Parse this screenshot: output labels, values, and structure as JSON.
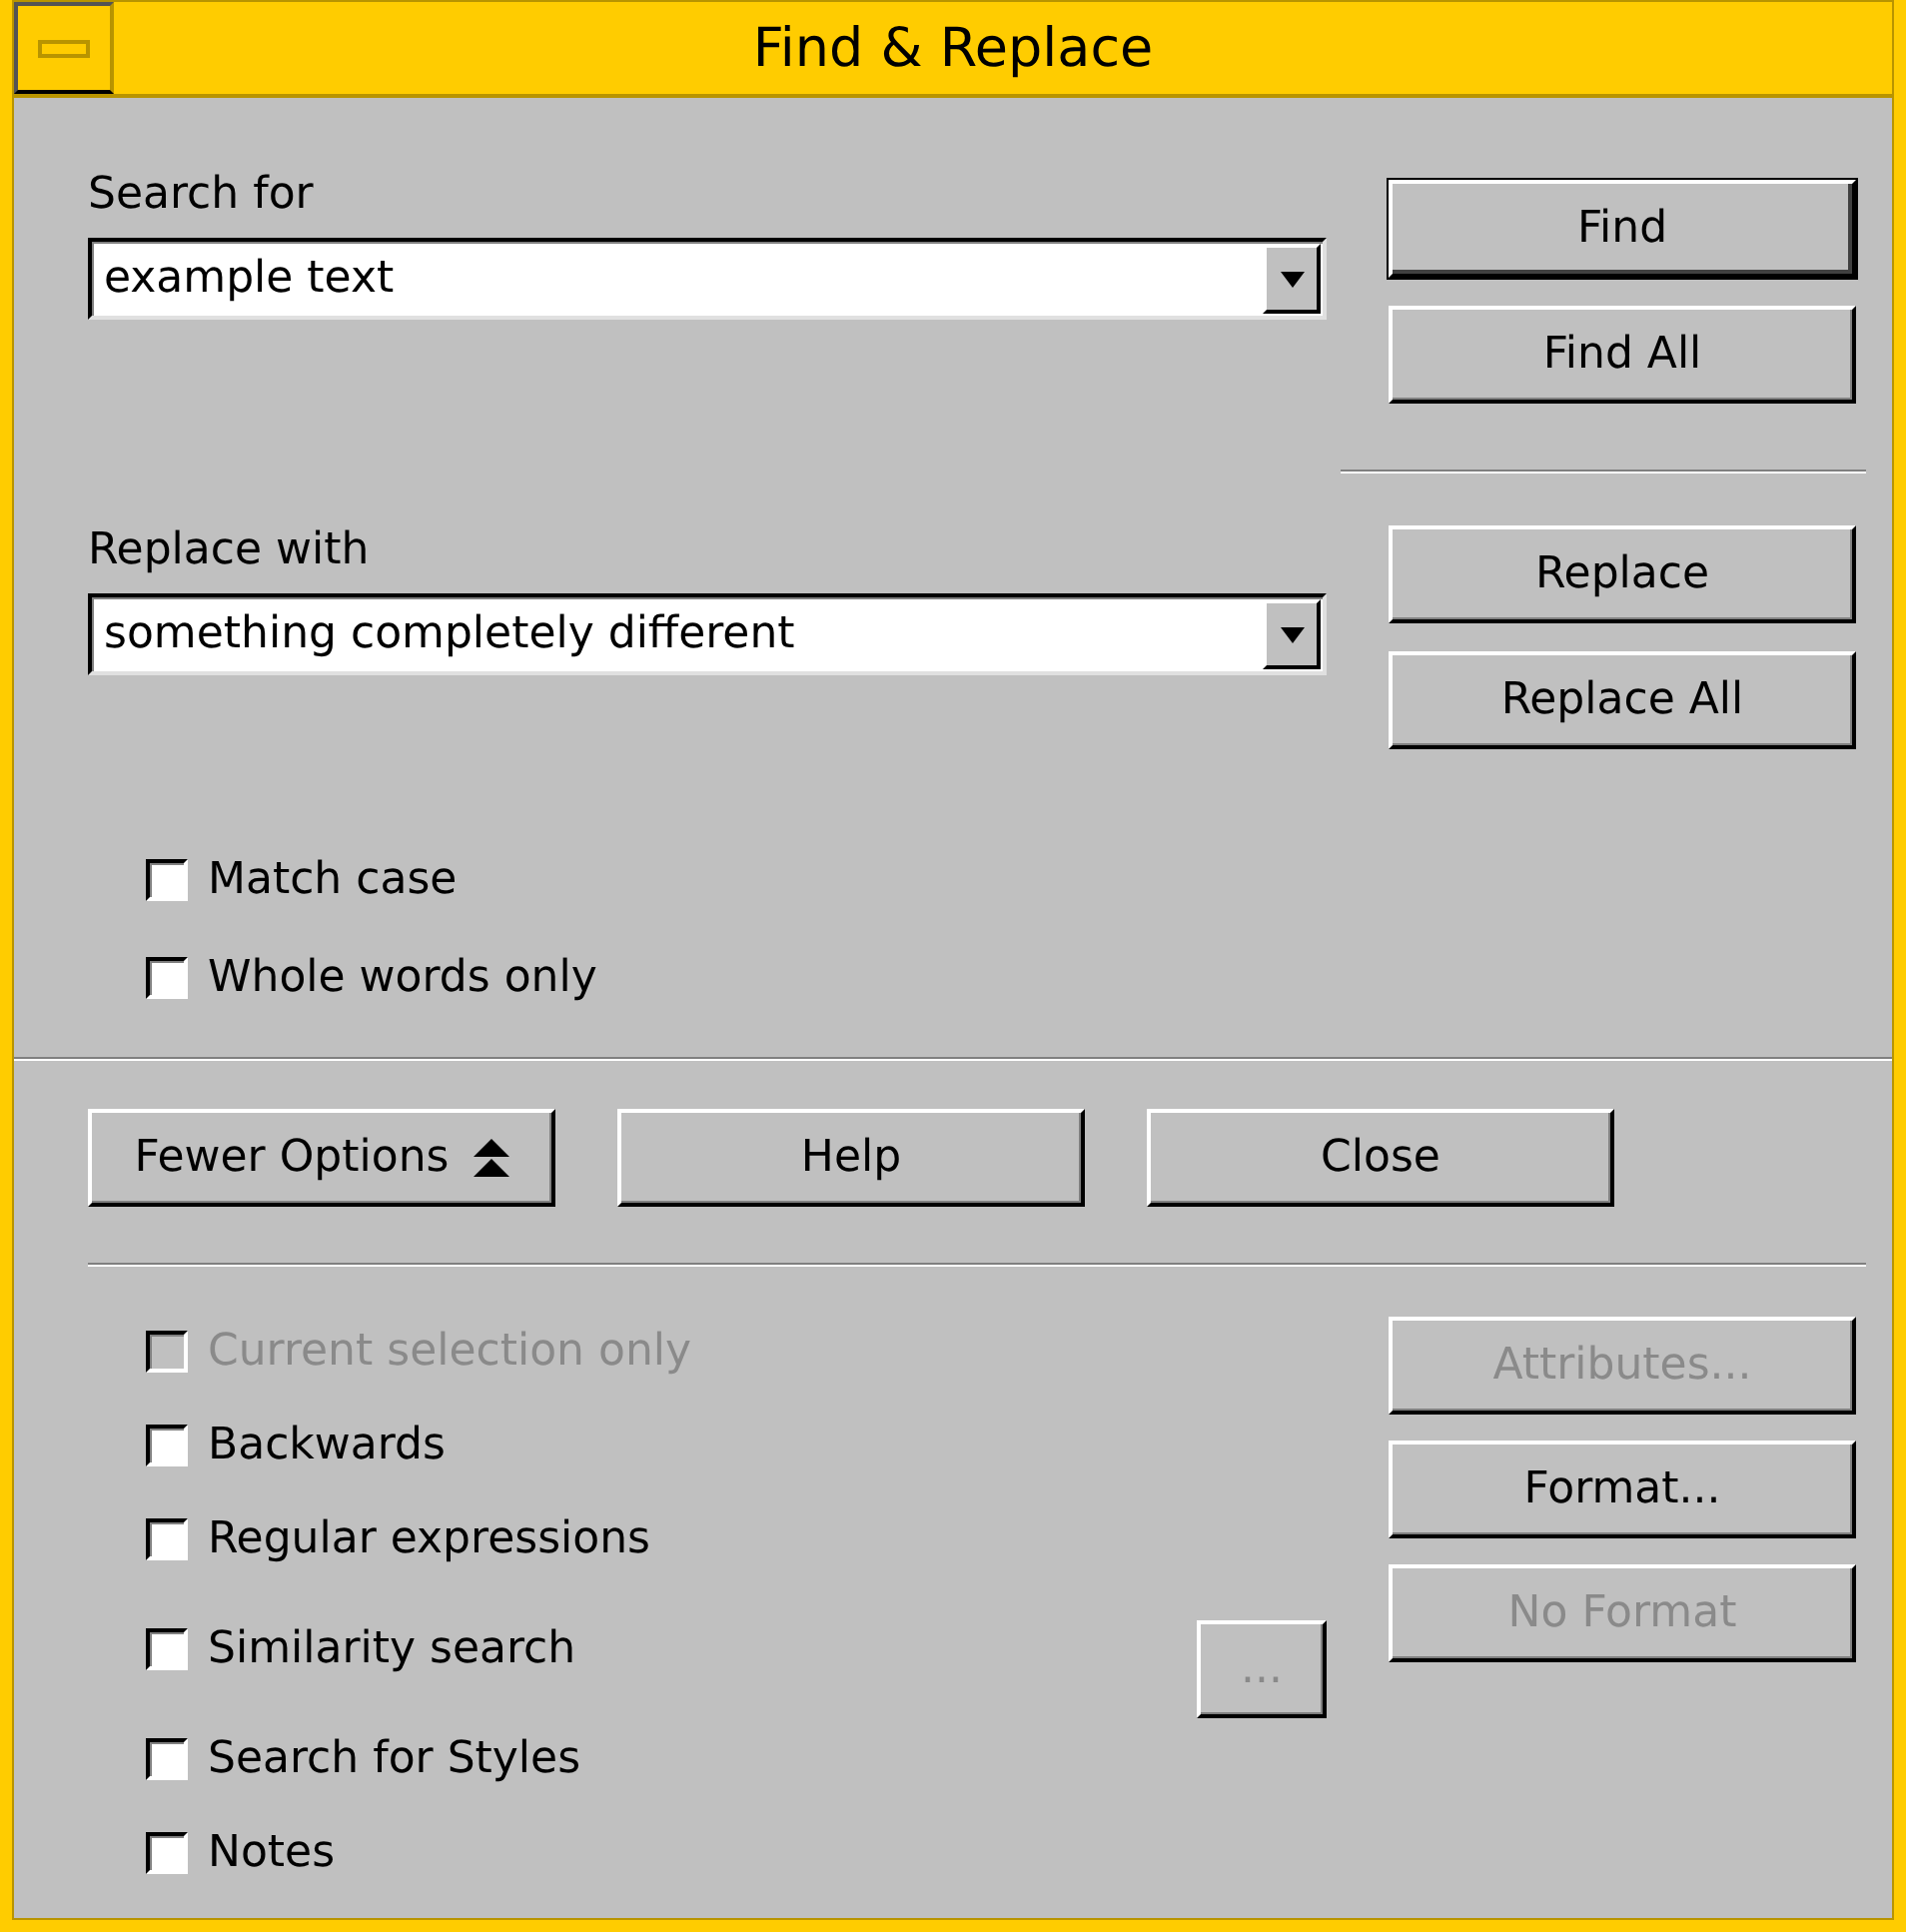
{
  "window": {
    "title": "Find & Replace"
  },
  "search": {
    "label": "Search for",
    "value": "example text",
    "buttons": [
      {
        "label": "Find",
        "default": true,
        "disabled": false
      },
      {
        "label": "Find All",
        "default": false,
        "disabled": false
      }
    ]
  },
  "replace": {
    "label": "Replace with",
    "value": "something completely different",
    "buttons": [
      {
        "label": "Replace",
        "default": false,
        "disabled": false
      },
      {
        "label": "Replace All",
        "default": false,
        "disabled": false
      }
    ]
  },
  "options": [
    {
      "label": "Match case",
      "checked": false,
      "disabled": false
    },
    {
      "label": "Whole words only",
      "checked": false,
      "disabled": false
    }
  ],
  "action_buttons": [
    {
      "kind": "toggle",
      "label": "Fewer Options",
      "default": false,
      "disabled": false
    },
    {
      "kind": "plain",
      "label": "Help",
      "default": false,
      "disabled": false
    },
    {
      "kind": "plain",
      "label": "Close",
      "default": false,
      "disabled": false
    }
  ],
  "more_options": [
    {
      "label": "Current selection only",
      "checked": false,
      "disabled": true
    },
    {
      "label": "Backwards",
      "checked": false,
      "disabled": false
    },
    {
      "label": "Regular expressions",
      "checked": false,
      "disabled": false
    },
    {
      "label": "Similarity search",
      "checked": false,
      "disabled": false,
      "settings_button": {
        "label": "...",
        "default": false,
        "disabled": true
      }
    },
    {
      "label": "Search for Styles",
      "checked": false,
      "disabled": false
    },
    {
      "label": "Notes",
      "checked": false,
      "disabled": false
    }
  ],
  "side_buttons": [
    {
      "label": "Attributes...",
      "default": false,
      "disabled": true
    },
    {
      "label": "Format...",
      "default": false,
      "disabled": false
    },
    {
      "label": "No Format",
      "default": false,
      "disabled": true
    }
  ]
}
